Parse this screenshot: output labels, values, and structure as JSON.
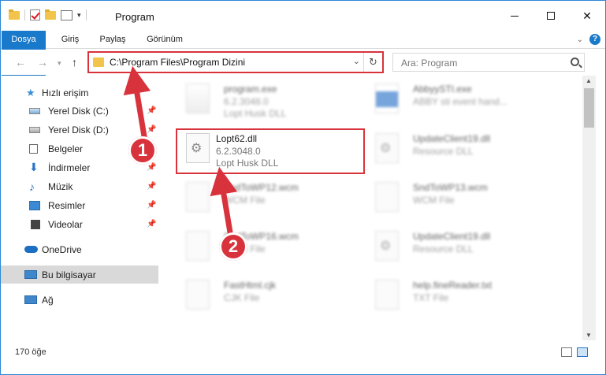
{
  "window": {
    "title": "Program"
  },
  "ribbon": {
    "tabs": [
      "Dosya",
      "Giriş",
      "Paylaş",
      "Görünüm"
    ],
    "help_icon": "question-icon"
  },
  "address": {
    "path": "C:\\Program Files\\Program Dizini",
    "search_placeholder": "Ara: Program"
  },
  "sidebar": {
    "items": [
      {
        "label": "Hızlı erişim",
        "icon": "star-icon",
        "pinned": false
      },
      {
        "label": "Yerel Disk (C:)",
        "icon": "drive-icon",
        "pinned": true
      },
      {
        "label": "Yerel Disk (D:)",
        "icon": "drive-icon",
        "pinned": true
      },
      {
        "label": "Belgeler",
        "icon": "document-icon",
        "pinned": true
      },
      {
        "label": "İndirmeler",
        "icon": "download-icon",
        "pinned": true
      },
      {
        "label": "Müzik",
        "icon": "music-icon",
        "pinned": true
      },
      {
        "label": "Resimler",
        "icon": "pictures-icon",
        "pinned": true
      },
      {
        "label": "Videolar",
        "icon": "videos-icon",
        "pinned": true
      },
      {
        "label": "OneDrive",
        "icon": "cloud-icon",
        "pinned": false
      },
      {
        "label": "Bu bilgisayar",
        "icon": "computer-icon",
        "pinned": false,
        "selected": true
      },
      {
        "label": "Ağ",
        "icon": "network-icon",
        "pinned": false
      }
    ]
  },
  "files": [
    {
      "name": "program.exe",
      "meta1": "6.2.3048.0",
      "meta2": "Lopt Husk DLL",
      "blurred": true,
      "icon": "exe"
    },
    {
      "name": "AbbyySTI.exe",
      "meta1": "ABBY sti event hand...",
      "meta2": "",
      "blurred": true,
      "icon": "blue"
    },
    {
      "name": "Lopt62.dll",
      "meta1": "6.2.3048.0",
      "meta2": "Lopt Husk DLL",
      "blurred": false,
      "icon": "gear"
    },
    {
      "name": "UpdateClient19.dll",
      "meta1": "Resource DLL",
      "meta2": "",
      "blurred": true,
      "icon": "gear"
    },
    {
      "name": "SndToWP12.wcm",
      "meta1": "WCM File",
      "meta2": "",
      "blurred": true,
      "icon": "blank"
    },
    {
      "name": "SndToWP13.wcm",
      "meta1": "WCM File",
      "meta2": "",
      "blurred": true,
      "icon": "blank"
    },
    {
      "name": "SndToWP16.wcm",
      "meta1": "WCM File",
      "meta2": "",
      "blurred": true,
      "icon": "blank"
    },
    {
      "name": "UpdateClient19.dll",
      "meta1": "Resource DLL",
      "meta2": "",
      "blurred": true,
      "icon": "gear"
    },
    {
      "name": "FastHtml.cjk",
      "meta1": "CJK File",
      "meta2": "",
      "blurred": true,
      "icon": "blank"
    },
    {
      "name": "help.fineReader.txt",
      "meta1": "TXT File",
      "meta2": "",
      "blurred": true,
      "icon": "blank"
    }
  ],
  "status": {
    "count": "170 öğe"
  },
  "annotations": {
    "badge1": "1",
    "badge2": "2",
    "highlight_color": "#d8333c"
  }
}
